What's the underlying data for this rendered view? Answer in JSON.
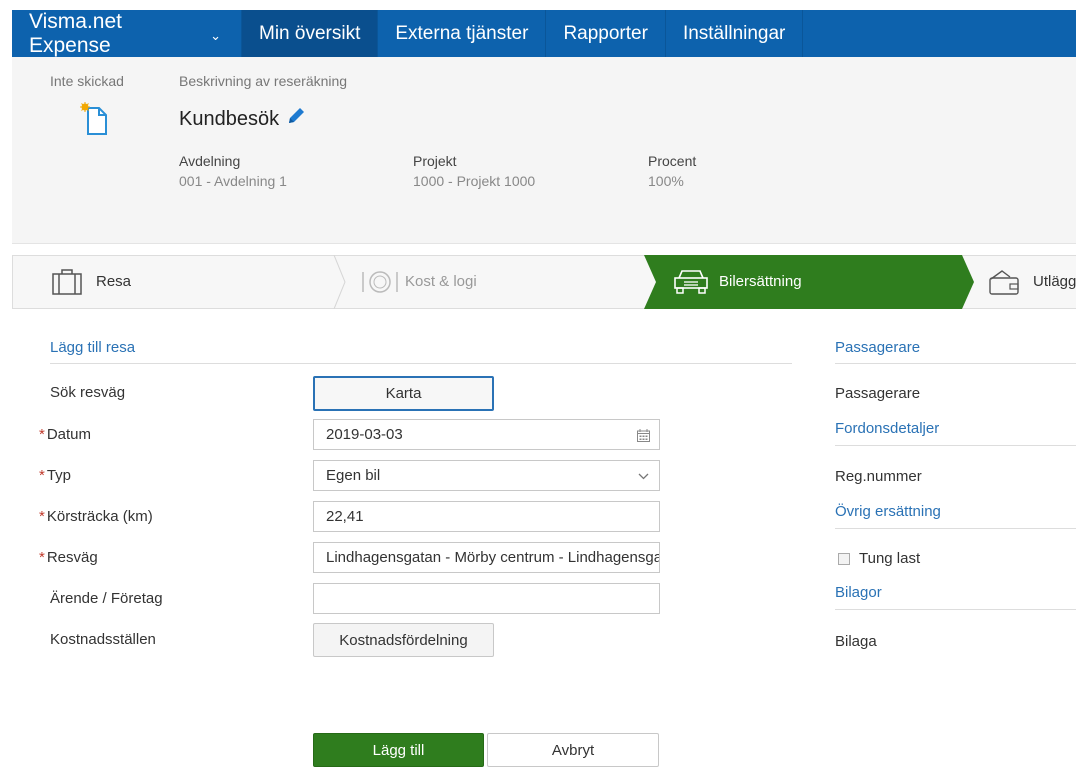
{
  "nav": {
    "brand": "Visma.net Expense",
    "items": [
      "Min översikt",
      "Externa tjänster",
      "Rapporter",
      "Inställningar"
    ]
  },
  "header": {
    "status": "Inte skickad",
    "description_label": "Beskrivning av reseräkning",
    "title": "Kundbesök",
    "meta": [
      {
        "label": "Avdelning",
        "value": "001 - Avdelning 1"
      },
      {
        "label": "Projekt",
        "value": "1000 - Projekt 1000"
      },
      {
        "label": "Procent",
        "value": "100%"
      }
    ]
  },
  "steps": [
    {
      "label": "Resa",
      "icon": "suitcase-icon"
    },
    {
      "label": "Kost & logi",
      "icon": "plate-icon"
    },
    {
      "label": "Bilersättning",
      "icon": "car-icon",
      "active": true
    },
    {
      "label": "Utlägg",
      "icon": "wallet-icon"
    }
  ],
  "form": {
    "section_title": "Lägg till resa",
    "labels": {
      "search_route": "Sök resväg",
      "date": "Datum",
      "type": "Typ",
      "distance": "Körsträcka (km)",
      "route": "Resväg",
      "errand": "Ärende / Företag",
      "cost_centers": "Kostnadsställen"
    },
    "map_button": "Karta",
    "date_value": "2019-03-03",
    "type_value": "Egen bil",
    "distance_value": "22,41",
    "route_value": "Lindhagensgatan - Mörby centrum - Lindhagensgatan",
    "errand_value": "",
    "cost_button": "Kostnadsfördelning",
    "add_button": "Lägg till",
    "cancel_button": "Avbryt"
  },
  "right": {
    "passengers_title": "Passagerare",
    "passengers_label": "Passagerare",
    "vehicle_title": "Fordonsdetaljer",
    "reg_label": "Reg.nummer",
    "other_title": "Övrig ersättning",
    "heavy_load_label": "Tung last",
    "attachments_title": "Bilagor",
    "attachment_label": "Bilaga"
  },
  "colors": {
    "nav": "#0d62ad",
    "active_step": "#2f7d1e",
    "link": "#2a72b5",
    "required": "#c0392b"
  }
}
